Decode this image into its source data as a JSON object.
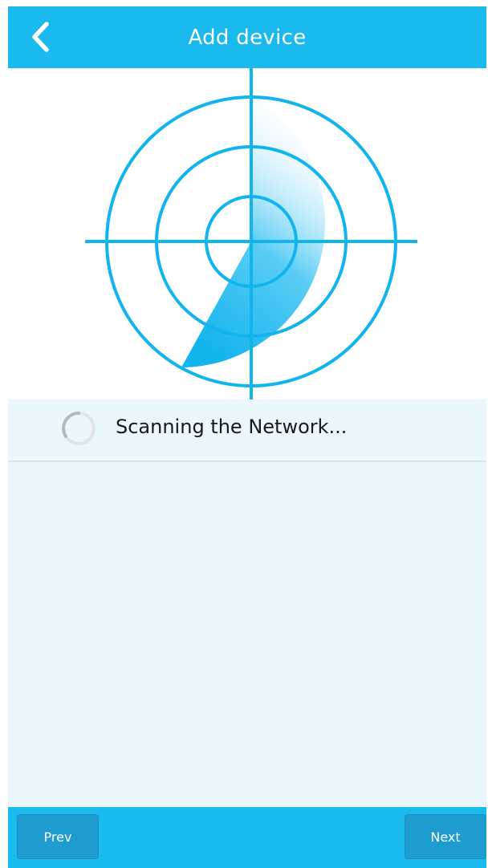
{
  "header": {
    "title": "Add device",
    "back_icon": "chevron-left-icon"
  },
  "status": {
    "text": "Scanning the Network...",
    "spinner_icon": "loading-spinner-icon"
  },
  "footer": {
    "prev_label": "Prev",
    "next_label": "Next"
  },
  "colors": {
    "accent": "#1ab9ee",
    "radar_line": "#12b4ee",
    "panel_background": "#eaf7fd",
    "button": "#1e9ccf"
  }
}
